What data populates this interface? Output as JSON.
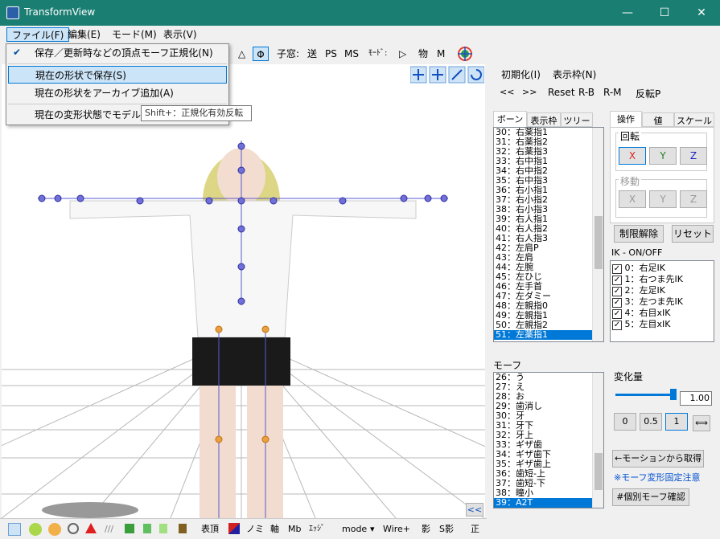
{
  "window": {
    "title": "TransformView",
    "min": "—",
    "max": "☐",
    "close": "✕"
  },
  "menu": [
    "ファイル(F)",
    "編集(E)",
    "モード(M)",
    "表示(V)"
  ],
  "file_menu": {
    "items": [
      "保存／更新時などの頂点モーフ正規化(N)",
      "現在の形状で保存(S)",
      "現在の形状をアーカイブ追加(A)",
      "現在の変形状態でモデル形"
    ],
    "check": "✔"
  },
  "tooltip": "Shift+：正規化有効反転",
  "toolbar": {
    "tri": "△",
    "phi": "Φ",
    "child": "子窓:",
    "send": "送",
    "ps": "PS",
    "ms": "MS",
    "mode_label": "ﾓｰﾄﾞ:",
    "play": "▷",
    "obj": "物",
    "m": "M"
  },
  "bottom": {
    "top": "表頂",
    "no": "ノミ",
    "axis": "軸",
    "mb": "Mb",
    "edge": "ｴｯｼﾞ",
    "mode": "mode",
    "wire": "Wire+",
    "shadow": "影",
    "sshadow": "S影",
    "front": "正"
  },
  "panel": {
    "init": "初期化(I)",
    "view": "表示枠(N)",
    "prev": "<<",
    "next": ">>",
    "reset": "Reset",
    "rb": "R-B",
    "rm": "R-M",
    "flip": "反転P",
    "bone_tabs": [
      "ボーン",
      "表示枠",
      "ツリー"
    ],
    "bones": [
      "30：右薬指1",
      "31：右薬指2",
      "32：右薬指3",
      "33：右中指1",
      "34：右中指2",
      "35：右中指3",
      "36：右小指1",
      "37：右小指2",
      "38：右小指3",
      "39：右人指1",
      "40：右人指2",
      "41：右人指3",
      "42：左肩P",
      "43：左肩",
      "44：左腕",
      "45：左ひじ",
      "46：左手首",
      "47：左ダミー",
      "48：左親指0",
      "49：左親指1",
      "50：左親指2",
      "51：左薬指1"
    ],
    "op_tabs": [
      "操作",
      "値",
      "スケール"
    ],
    "rotate": "回転",
    "move": "移動",
    "x": "X",
    "y": "Y",
    "z": "Z",
    "unlimit": "制限解除",
    "reset_btn": "リセット",
    "ik_title": "IK - ON/OFF",
    "ik": [
      "0：右足IK",
      "1：右つま先IK",
      "2：左足IK",
      "3：左つま先IK",
      "4：右目xIK",
      "5：左目xIK"
    ],
    "morph_label": "モーフ",
    "morphs": [
      "26：う",
      "27：え",
      "28：お",
      "29：歯消し",
      "30：牙",
      "31：牙下",
      "32：牙上",
      "33：ギザ歯",
      "34：ギザ歯下",
      "35：ギザ歯上",
      "36：歯短-上",
      "37：歯短-下",
      "38：瞳小",
      "39：A2T"
    ],
    "amount_label": "変化量",
    "amount_value": "1.00",
    "amount_fraction": 1.0,
    "q0": "0",
    "q05": "0.5",
    "q1": "1",
    "swap": "⟺",
    "get_motion": "←モーションから取得",
    "note": "※モーフ変形固定注意",
    "confirm": "#個別モーフ確認",
    "collapse": "<<"
  }
}
